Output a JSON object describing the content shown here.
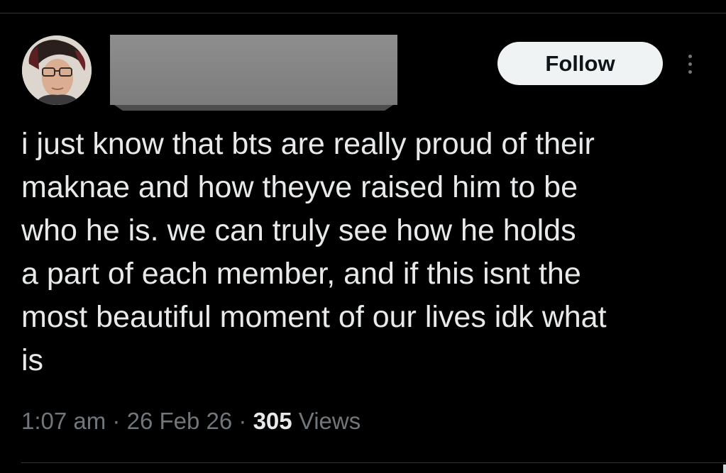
{
  "author": {
    "name_redacted": true
  },
  "actions": {
    "follow_label": "Follow",
    "more_icon": "ellipsis-vertical-icon"
  },
  "post": {
    "lines": [
      "i just know that bts are really proud of their",
      "maknae and how theyve raised him to be",
      "who he is. we can truly see how he holds",
      "a part of each member, and if this isnt the",
      "most beautiful moment of our lives idk what",
      "is"
    ]
  },
  "meta": {
    "time": "1:07 am",
    "separator": "·",
    "date": "26 Feb 26",
    "views_count": "305",
    "views_label": "Views"
  },
  "colors": {
    "background": "#000000",
    "text_primary": "#e7e9ea",
    "text_secondary": "#71767b",
    "button_bg": "#eff3f4",
    "divider": "#2f3336"
  }
}
